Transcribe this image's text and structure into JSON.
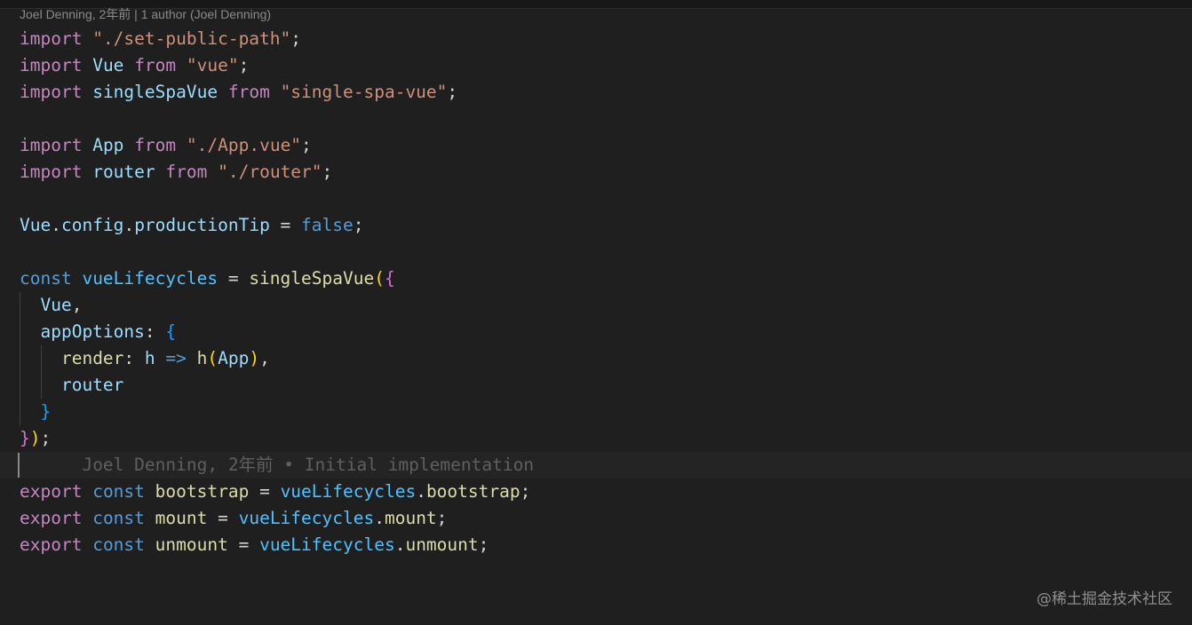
{
  "codelens": {
    "text": "Joel Denning, 2年前 | 1 author (Joel Denning)"
  },
  "code": {
    "l1": {
      "import": "import",
      "path": "\"./set-public-path\"",
      "semi": ";"
    },
    "l2": {
      "import": "import",
      "name": "Vue",
      "from": "from",
      "path": "\"vue\"",
      "semi": ";"
    },
    "l3": {
      "import": "import",
      "name": "singleSpaVue",
      "from": "from",
      "path": "\"single-spa-vue\"",
      "semi": ";"
    },
    "l5": {
      "import": "import",
      "name": "App",
      "from": "from",
      "path": "\"./App.vue\"",
      "semi": ";"
    },
    "l6": {
      "import": "import",
      "name": "router",
      "from": "from",
      "path": "\"./router\"",
      "semi": ";"
    },
    "l8": {
      "obj": "Vue",
      "dot1": ".",
      "p1": "config",
      "dot2": ".",
      "p2": "productionTip",
      "eq": " = ",
      "val": "false",
      "semi": ";"
    },
    "l10": {
      "const": "const",
      "name": "vueLifecycles",
      "eq": " = ",
      "fn": "singleSpaVue",
      "paren": "(",
      "brace": "{"
    },
    "l11": {
      "text": "Vue",
      "comma": ","
    },
    "l12": {
      "key": "appOptions",
      "colon": ": ",
      "brace": "{"
    },
    "l13": {
      "key": "render",
      "colon": ": ",
      "arg": "h",
      "arrow": " => ",
      "fn": "h",
      "open": "(",
      "arg2": "App",
      "close": ")",
      "comma": ","
    },
    "l14": {
      "text": "router"
    },
    "l15": {
      "brace": "}"
    },
    "l16": {
      "brace": "}",
      "paren": ")",
      "semi": ";"
    },
    "l17": {
      "blame": "Joel Denning, 2年前 • Initial implementation"
    },
    "l18": {
      "export": "export",
      "const": "const",
      "name": "bootstrap",
      "eq": " = ",
      "obj": "vueLifecycles",
      "dot": ".",
      "prop": "bootstrap",
      "semi": ";"
    },
    "l19": {
      "export": "export",
      "const": "const",
      "name": "mount",
      "eq": " = ",
      "obj": "vueLifecycles",
      "dot": ".",
      "prop": "mount",
      "semi": ";"
    },
    "l20": {
      "export": "export",
      "const": "const",
      "name": "unmount",
      "eq": " = ",
      "obj": "vueLifecycles",
      "dot": ".",
      "prop": "unmount",
      "semi": ";"
    }
  },
  "watermark": {
    "text": "@稀土掘金技术社区"
  },
  "colors": {
    "background": "#1f1f1f",
    "keyword": "#c586c0",
    "string": "#ce9178",
    "variable": "#9cdcfe",
    "constant": "#4fc1ff",
    "function": "#dcdcaa",
    "boolean": "#569cd6",
    "bracket_1": "#ffd700",
    "bracket_2": "#da70d6",
    "bracket_3": "#179fff"
  }
}
